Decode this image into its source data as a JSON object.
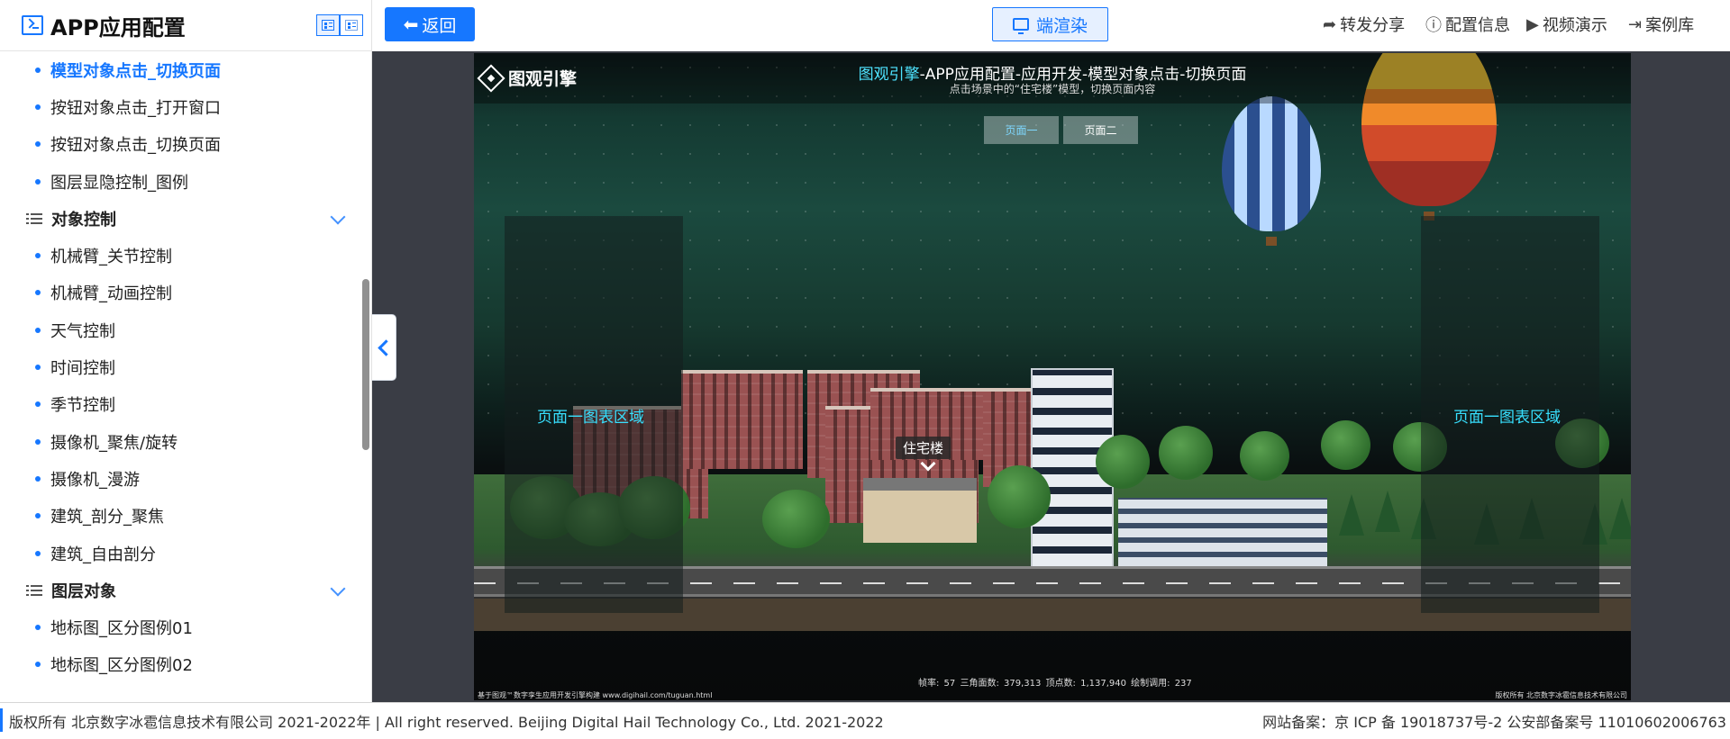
{
  "sidebar": {
    "title": "APP应用配置",
    "items": [
      {
        "type": "item",
        "label": "模型对象点击_切换页面",
        "active": true
      },
      {
        "type": "item",
        "label": "按钮对象点击_打开窗口"
      },
      {
        "type": "item",
        "label": "按钮对象点击_切换页面"
      },
      {
        "type": "item",
        "label": "图层显隐控制_图例"
      },
      {
        "type": "group",
        "label": "对象控制"
      },
      {
        "type": "item",
        "label": "机械臂_关节控制"
      },
      {
        "type": "item",
        "label": "机械臂_动画控制"
      },
      {
        "type": "item",
        "label": "天气控制"
      },
      {
        "type": "item",
        "label": "时间控制"
      },
      {
        "type": "item",
        "label": "季节控制"
      },
      {
        "type": "item",
        "label": "摄像机_聚焦/旋转"
      },
      {
        "type": "item",
        "label": "摄像机_漫游"
      },
      {
        "type": "item",
        "label": "建筑_剖分_聚焦"
      },
      {
        "type": "item",
        "label": "建筑_自由剖分"
      },
      {
        "type": "group",
        "label": "图层对象"
      },
      {
        "type": "item",
        "label": "地标图_区分图例01"
      },
      {
        "type": "item",
        "label": "地标图_区分图例02"
      }
    ]
  },
  "topbar": {
    "back_label": "返回",
    "render_label": "端渲染",
    "actions": {
      "share": "转发分享",
      "config": "配置信息",
      "video": "视频演示",
      "cases": "案例库"
    }
  },
  "scene": {
    "logo_text": "图观引擎",
    "title_accent": "图观引擎",
    "title_rest": "-APP应用配置-应用开发-模型对象点击-切换页面",
    "subtitle": "点击场景中的“住宅楼”模型，切换页面内容",
    "page_buttons": [
      "页面一",
      "页面二"
    ],
    "panel_left_label": "页面一图表区域",
    "panel_right_label": "页面一图表区域",
    "tag_label": "住宅楼",
    "stats": "帧率:  57     三角面数:  379,313     顶点数:  1,137,940     绘制调用:  237",
    "footer_left": "基于图观™数字孪生应用开发引擎构建 www.digihail.com/tuguan.html",
    "footer_right": "版权所有 北京数字冰雹信息技术有限公司"
  },
  "footer": {
    "copyright": "版权所有 北京数字冰雹信息技术有限公司 2021-2022年 | All right reserved. Beijing Digital Hail Technology Co., Ltd. 2021-2022",
    "icp": "网站备案：京 ICP 备 19018737号-2 公安部备案号 11010602006763"
  },
  "colors": {
    "accent": "#1677ff",
    "scene_label": "#37e0ff"
  },
  "icons": {
    "app": "app-terminal-icon",
    "share": "share-arrow-icon",
    "config": "info-circle-icon",
    "video": "play-circle-icon",
    "cases": "case-library-icon"
  }
}
